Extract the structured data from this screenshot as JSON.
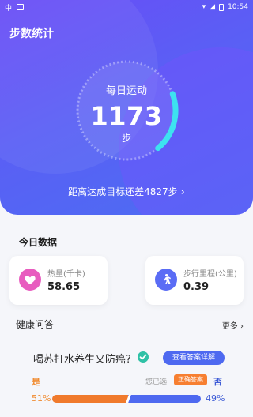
{
  "status": {
    "left_icons": [
      "carrier-icon",
      "notification-icon"
    ],
    "time": "10:54"
  },
  "header": {
    "title": "步数统计"
  },
  "ring": {
    "label": "每日运动",
    "steps": "1173",
    "unit": "步",
    "progress": 0.195
  },
  "remaining": {
    "text": "距离达成目标还差4827步"
  },
  "today": {
    "title": "今日数据",
    "cards": [
      {
        "label": "热量(千卡)",
        "value": "58.65",
        "icon": "heart-icon",
        "color": "#e85cbf"
      },
      {
        "label": "步行里程(公里)",
        "value": "0.39",
        "icon": "walking-icon",
        "color": "#5a6cf5"
      }
    ]
  },
  "qa": {
    "title": "健康问答",
    "more": "更多",
    "question": "喝苏打水养生又防癌?",
    "detail_button": "查看答案详解",
    "yes_label": "是",
    "no_label": "否",
    "chosen_text": "您已选",
    "correct_badge": "正确答案",
    "yes_pct_text": "51%",
    "no_pct_text": "49%",
    "yes_pct": 0.51,
    "no_pct": 0.49
  },
  "colors": {
    "accent": "#4e69f0",
    "hero_start": "#6a4cf6",
    "ring_active": "#3de2f0",
    "yes": "#f07a2c",
    "no": "#4e69f0"
  }
}
